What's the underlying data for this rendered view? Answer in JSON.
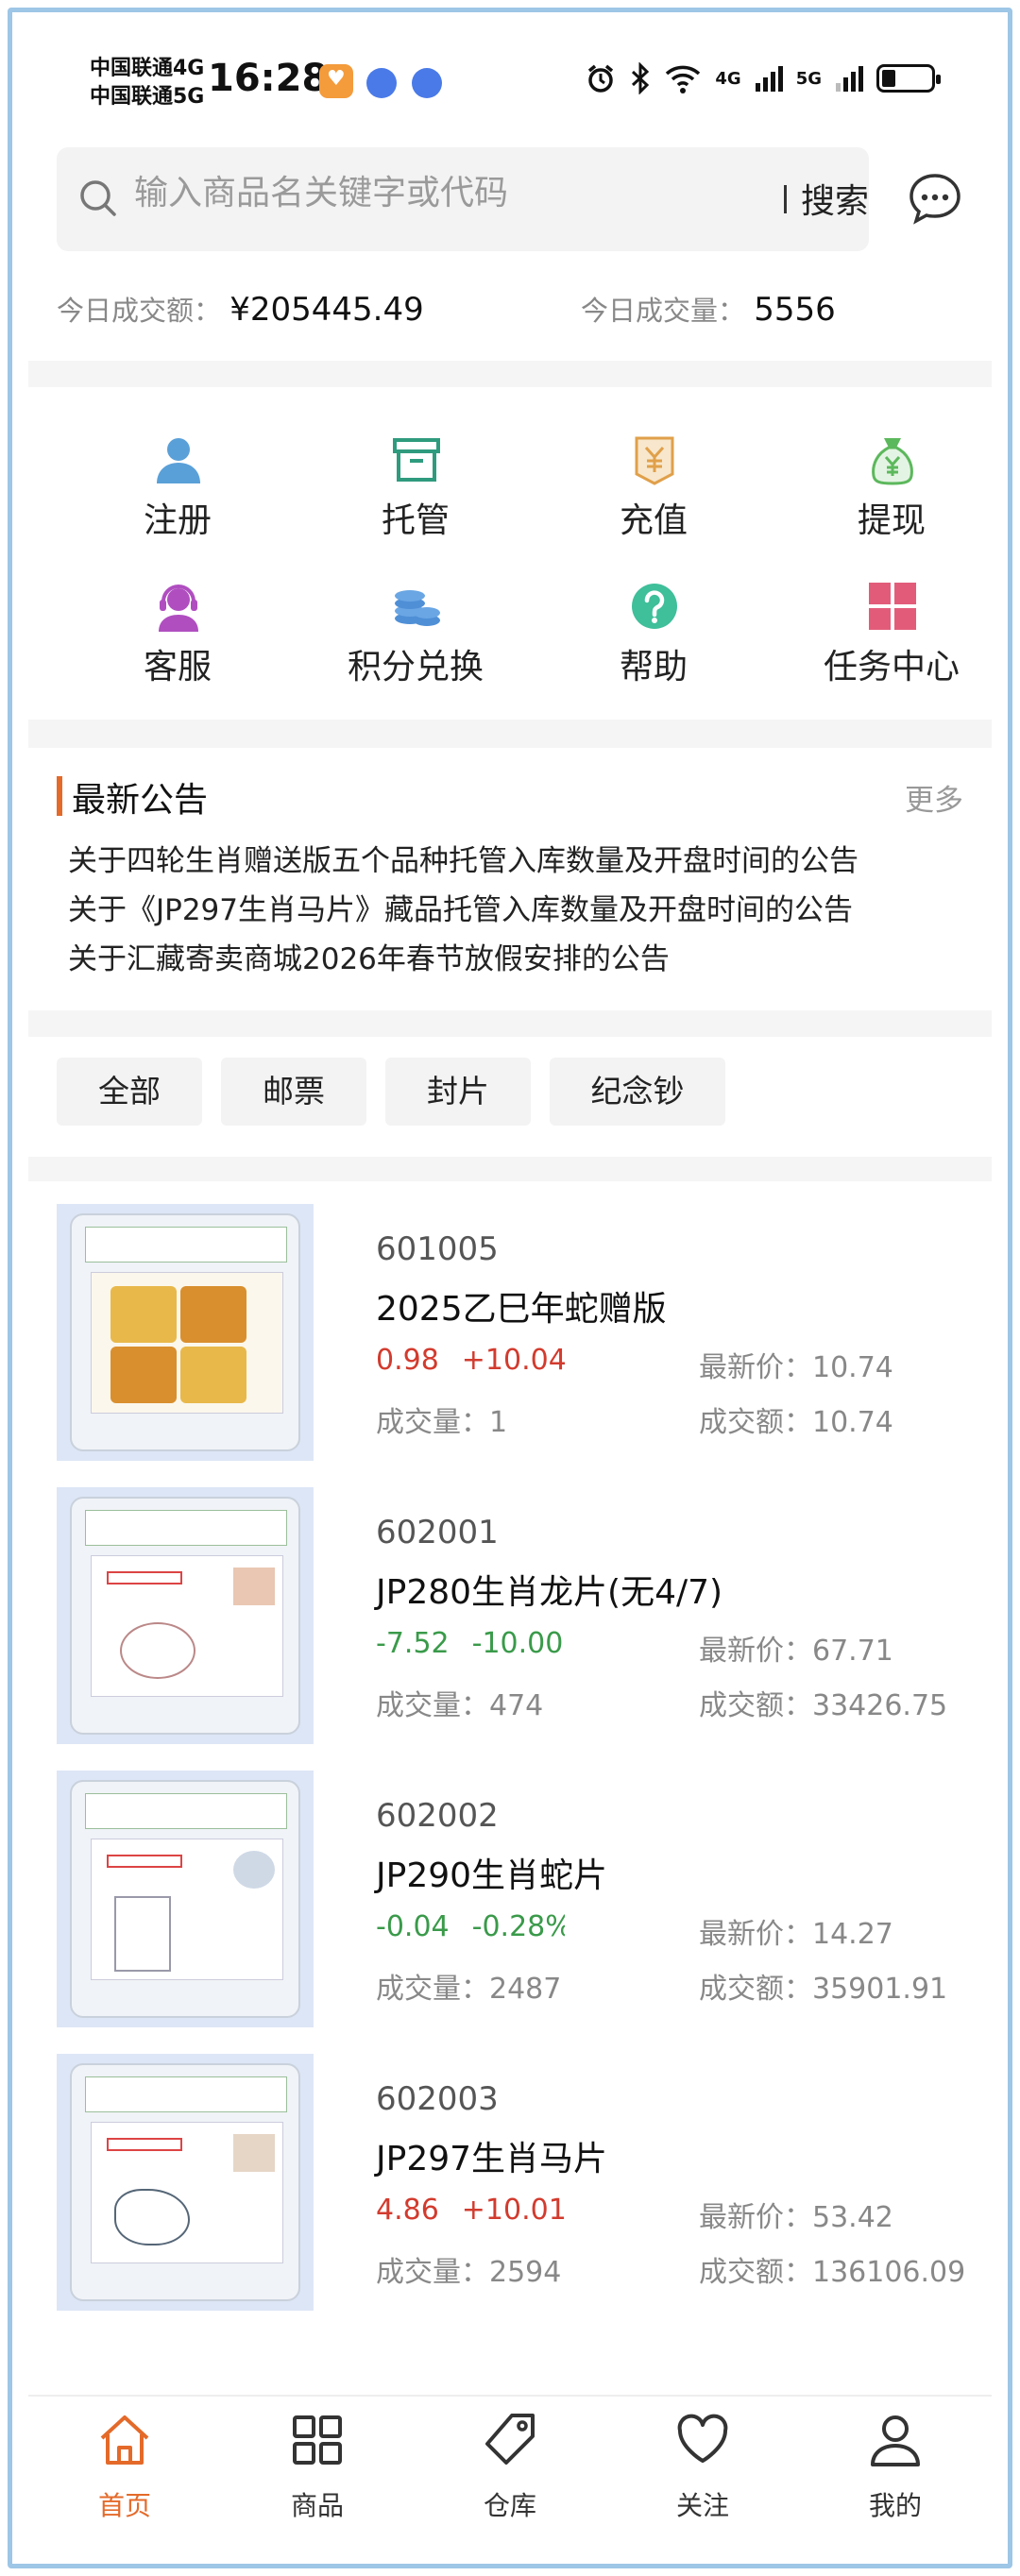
{
  "status_bar": {
    "carrier_1": "中国联通4G",
    "carrier_2": "中国联通5G",
    "time": "16:28",
    "net_1": "4G",
    "net_2": "5G"
  },
  "search": {
    "placeholder": "输入商品名关键字或代码",
    "button": "搜索"
  },
  "stats": {
    "turnover_label": "今日成交额：",
    "turnover_value": "¥205445.49",
    "volume_label": "今日成交量：",
    "volume_value": "5556"
  },
  "grid": [
    {
      "label": "注册",
      "icon": "user-icon",
      "color": "#5aa0d8"
    },
    {
      "label": "托管",
      "icon": "box-icon",
      "color": "#2f9b7e"
    },
    {
      "label": "充值",
      "icon": "yen-bag-icon",
      "color": "#e0a04a"
    },
    {
      "label": "提现",
      "icon": "money-bag-icon",
      "color": "#5cb85c"
    },
    {
      "label": "客服",
      "icon": "headset-icon",
      "color": "#b04ec0"
    },
    {
      "label": "积分兑换",
      "icon": "coins-icon",
      "color": "#4f8fd6"
    },
    {
      "label": "帮助",
      "icon": "help-icon",
      "color": "#3fbf9a"
    },
    {
      "label": "任务中心",
      "icon": "grid-icon",
      "color": "#e25c7a"
    }
  ],
  "notice": {
    "title": "最新公告",
    "more": "更多",
    "items": [
      "关于四轮生肖赠送版五个品种托管入库数量及开盘时间的公告",
      "关于《JP297生肖马片》藏品托管入库数量及开盘时间的公告",
      "关于汇藏寄卖商城2026年春节放假安排的公告"
    ]
  },
  "filters": [
    "全部",
    "邮票",
    "封片",
    "纪念钞"
  ],
  "labels": {
    "latest": "最新价：",
    "volume": "成交量：",
    "amount": "成交额："
  },
  "products": [
    {
      "code": "601005",
      "name": "2025乙巳年蛇赠版",
      "change": "0.98",
      "pct": "+10.04%",
      "dir": "up",
      "latest": "10.74",
      "volume": "1",
      "amount": "10.74"
    },
    {
      "code": "602001",
      "name": "JP280生肖龙片(无4/7)",
      "change": "-7.52",
      "pct": "-10.00",
      "dir": "down",
      "latest": "67.71",
      "volume": "474",
      "amount": "33426.75"
    },
    {
      "code": "602002",
      "name": "JP290生肖蛇片",
      "change": "-0.04",
      "pct": "-0.28%",
      "dir": "down",
      "latest": "14.27",
      "volume": "2487",
      "amount": "35901.91"
    },
    {
      "code": "602003",
      "name": "JP297生肖马片",
      "change": "4.86",
      "pct": "+10.01%",
      "dir": "up",
      "latest": "53.42",
      "volume": "2594",
      "amount": "136106.09"
    }
  ],
  "tabbar": [
    {
      "label": "首页",
      "icon": "home-icon",
      "active": true
    },
    {
      "label": "商品",
      "icon": "apps-icon",
      "active": false
    },
    {
      "label": "仓库",
      "icon": "tag-icon",
      "active": false
    },
    {
      "label": "关注",
      "icon": "heart-icon",
      "active": false
    },
    {
      "label": "我的",
      "icon": "person-icon",
      "active": false
    }
  ],
  "colors": {
    "accent": "#e46a2a",
    "up": "#d23b2e",
    "down": "#3a9a4a",
    "frame": "#9ec6e6"
  }
}
